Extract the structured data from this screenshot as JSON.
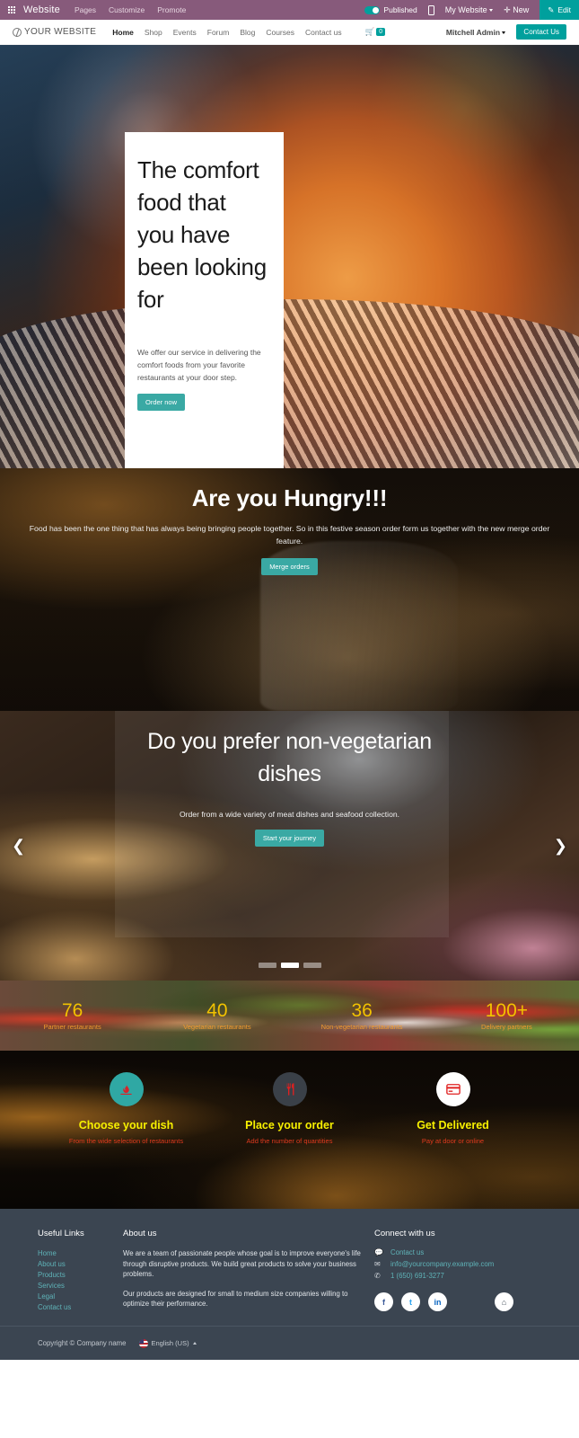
{
  "odoo_bar": {
    "apps_icon": "grid-apps-icon",
    "brand": "Website",
    "menus": [
      "Pages",
      "Customize",
      "Promote"
    ],
    "published_label": "Published",
    "mobile_icon": "mobile-preview-icon",
    "my_website": "My Website",
    "new_label": "New",
    "new_icon": "plus-icon",
    "edit_label": "Edit",
    "edit_icon": "pencil-icon",
    "bar_color": "#875a7b",
    "accent_color": "#00a09d"
  },
  "site_nav": {
    "logo_text": "YOUR WEBSITE",
    "logo_icon": "globe-icon",
    "links": [
      "Home",
      "Shop",
      "Events",
      "Forum",
      "Blog",
      "Courses",
      "Contact us"
    ],
    "active_link": "Home",
    "cart_icon": "shopping-cart-icon",
    "cart_count": "0",
    "user": "Mitchell Admin",
    "cta": "Contact Us"
  },
  "hero": {
    "title": "The comfort food that you have been looking for",
    "subtitle": "We offer our service in delivering the comfort foods from your favorite restaurants at your door step.",
    "button": "Order now"
  },
  "hungry": {
    "title": "Are you Hungry!!!",
    "text": "Food has been the one thing that has always being bringing people together. So in this festive season order form us together with the new merge order feature.",
    "button": "Merge orders"
  },
  "carousel": {
    "title": "Do you prefer non-vegetarian dishes",
    "text": "Order from a wide variety of meat dishes and seafood collection.",
    "button": "Start your journey",
    "prev_icon": "chevron-left-icon",
    "next_icon": "chevron-right-icon",
    "slides": 3,
    "active_slide": 2
  },
  "stats": [
    {
      "num": "76",
      "label": "Partner restaurants"
    },
    {
      "num": "40",
      "label": "Vegetarian restaurants"
    },
    {
      "num": "36",
      "label": "Non-vegetarian restaurants"
    },
    {
      "num": "100+",
      "label": "Delivery partners"
    }
  ],
  "steps": [
    {
      "icon": "flame-dish-icon",
      "title": "Choose your dish",
      "desc": "From the wide selection of restaurants",
      "circle": "teal"
    },
    {
      "icon": "fork-knife-icon",
      "title": "Place your order",
      "desc": "Add the number of quantities",
      "circle": "dark"
    },
    {
      "icon": "credit-card-icon",
      "title": "Get Delivered",
      "desc": "Pay at door or online",
      "circle": "white"
    }
  ],
  "footer": {
    "useful_links_head": "Useful Links",
    "useful_links": [
      "Home",
      "About us",
      "Products",
      "Services",
      "Legal",
      "Contact us"
    ],
    "about_head": "About us",
    "about_p1": "We are a team of passionate people whose goal is to improve everyone's life through disruptive products. We build great products to solve your business problems.",
    "about_p2": "Our products are designed for small to medium size companies willing to optimize their performance.",
    "connect_head": "Connect with us",
    "contact_link": "Contact us",
    "contact_icon": "comment-icon",
    "email": "info@yourcompany.example.com",
    "email_icon": "envelope-icon",
    "phone": "1 (650) 691-3277",
    "phone_icon": "phone-icon",
    "socials": [
      {
        "name": "facebook-icon",
        "glyph": "f"
      },
      {
        "name": "twitter-icon",
        "glyph": "t"
      },
      {
        "name": "linkedin-icon",
        "glyph": "in"
      },
      {
        "name": "home-icon",
        "glyph": "⌂"
      }
    ],
    "copyright": "Copyright © Company name",
    "language": "English (US)",
    "flag_icon": "us-flag-icon"
  }
}
